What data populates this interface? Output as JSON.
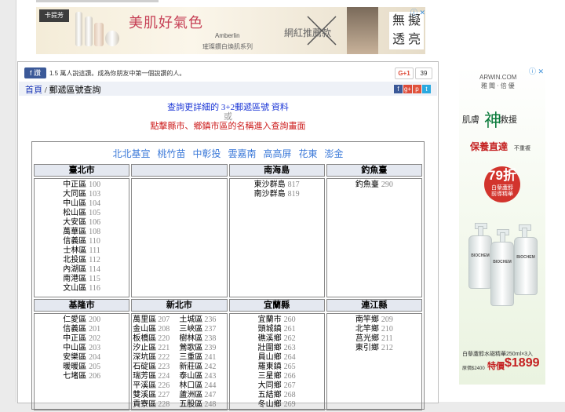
{
  "top_ad": {
    "logo": "卡提芳",
    "headline": "美肌好氣色",
    "brand": "Amberlin",
    "tagline": "璀璨鑽白煥肌系列",
    "network_label": "網紅推薦款",
    "no_ad_label": "無 擬 透 亮",
    "close_label": "ⓘ ✕"
  },
  "social": {
    "fb_label": "f 讚",
    "fb_text": "1.5 萬人說這讚。成為你朋友中第一個說讚的人。",
    "gplus_label": "G+1",
    "gplus_count": "39"
  },
  "breadcrumb": {
    "home": "首頁",
    "separator": "/",
    "current": "郵遞區號查詢"
  },
  "share_icons": [
    "f",
    "g+",
    "p",
    "t"
  ],
  "intro": {
    "line1_prefix": "查詢更詳細的 ",
    "line1_link": "3+2郵遞區號",
    "line1_suffix": " 資料",
    "line2": "或",
    "line3": "點擊縣市、鄉鎮市區的名稱進入查詢畫面"
  },
  "region_links": "北北基宜 桃竹苗 中彰投 雲嘉南 高高屏 花東 澎金",
  "blocks_row1": [
    {
      "name": "臺北市",
      "items": [
        [
          "中正區",
          "100"
        ],
        [
          "大同區",
          "103"
        ],
        [
          "中山區",
          "104"
        ],
        [
          "松山區",
          "105"
        ],
        [
          "大安區",
          "106"
        ],
        [
          "萬華區",
          "108"
        ],
        [
          "信義區",
          "110"
        ],
        [
          "士林區",
          "111"
        ],
        [
          "北投區",
          "112"
        ],
        [
          "內湖區",
          "114"
        ],
        [
          "南港區",
          "115"
        ],
        [
          "文山區",
          "116"
        ]
      ]
    },
    {
      "name": "",
      "items": []
    },
    {
      "name": "南海島",
      "items": [
        [
          "東沙群島",
          "817"
        ],
        [
          "南沙群島",
          "819"
        ]
      ]
    },
    {
      "name": "釣魚臺",
      "items": [
        [
          "釣魚臺",
          "290"
        ]
      ]
    }
  ],
  "blocks_row2": [
    {
      "name": "基隆市",
      "items": [
        [
          "仁愛區",
          "200"
        ],
        [
          "信義區",
          "201"
        ],
        [
          "中正區",
          "202"
        ],
        [
          "中山區",
          "203"
        ],
        [
          "安樂區",
          "204"
        ],
        [
          "暖暖區",
          "205"
        ],
        [
          "七堵區",
          "206"
        ]
      ]
    },
    {
      "name": "新北市",
      "items": [
        [
          "萬里區",
          "207"
        ],
        [
          "土城區",
          "236"
        ],
        [
          "金山區",
          "208"
        ],
        [
          "三峽區",
          "237"
        ],
        [
          "板橋區",
          "220"
        ],
        [
          "樹林區",
          "238"
        ],
        [
          "汐止區",
          "221"
        ],
        [
          "鶯歌區",
          "239"
        ],
        [
          "深坑區",
          "222"
        ],
        [
          "三重區",
          "241"
        ],
        [
          "石碇區",
          "223"
        ],
        [
          "新莊區",
          "242"
        ],
        [
          "瑞芳區",
          "224"
        ],
        [
          "泰山區",
          "243"
        ],
        [
          "平溪區",
          "226"
        ],
        [
          "林口區",
          "244"
        ],
        [
          "雙溪區",
          "227"
        ],
        [
          "蘆洲區",
          "247"
        ],
        [
          "貢寮區",
          "228"
        ],
        [
          "五股區",
          "248"
        ]
      ]
    },
    {
      "name": "宜蘭縣",
      "items": [
        [
          "宜蘭市",
          "260"
        ],
        [
          "頭城鎮",
          "261"
        ],
        [
          "礁溪鄉",
          "262"
        ],
        [
          "壯圍鄉",
          "263"
        ],
        [
          "員山鄉",
          "264"
        ],
        [
          "羅東鎮",
          "265"
        ],
        [
          "三星鄉",
          "266"
        ],
        [
          "大同鄉",
          "267"
        ],
        [
          "五結鄉",
          "268"
        ],
        [
          "冬山鄉",
          "269"
        ]
      ]
    },
    {
      "name": "連江縣",
      "items": [
        [
          "南竿鄉",
          "209"
        ],
        [
          "北竿鄉",
          "210"
        ],
        [
          "莒光鄉",
          "211"
        ],
        [
          "東引鄉",
          "212"
        ]
      ]
    }
  ],
  "right_ad": {
    "close_label": "ⓘ ✕",
    "brand1": "ARWIN.COM",
    "brand2": "雅 聞 · 倍 優",
    "headline_prefix": "肌膚",
    "headline_big": "神",
    "headline_suffix": "救援",
    "sub": "保養直達",
    "sub2": "不重複",
    "discount": "79折",
    "discount_l1": "白藜蘆醇",
    "discount_l2": "前導精華",
    "bottle_label": "BIOCHEM",
    "product": "白藜蘆醇水磁精華250ml×3入",
    "price_old": "原價$2400",
    "price_label": "特價",
    "price": "$1899"
  },
  "colors": {
    "link_blue": "#1b36d6",
    "link_red": "#cc1a1a",
    "header_bg": "#e4e8f0",
    "fb_blue": "#3b5998"
  }
}
